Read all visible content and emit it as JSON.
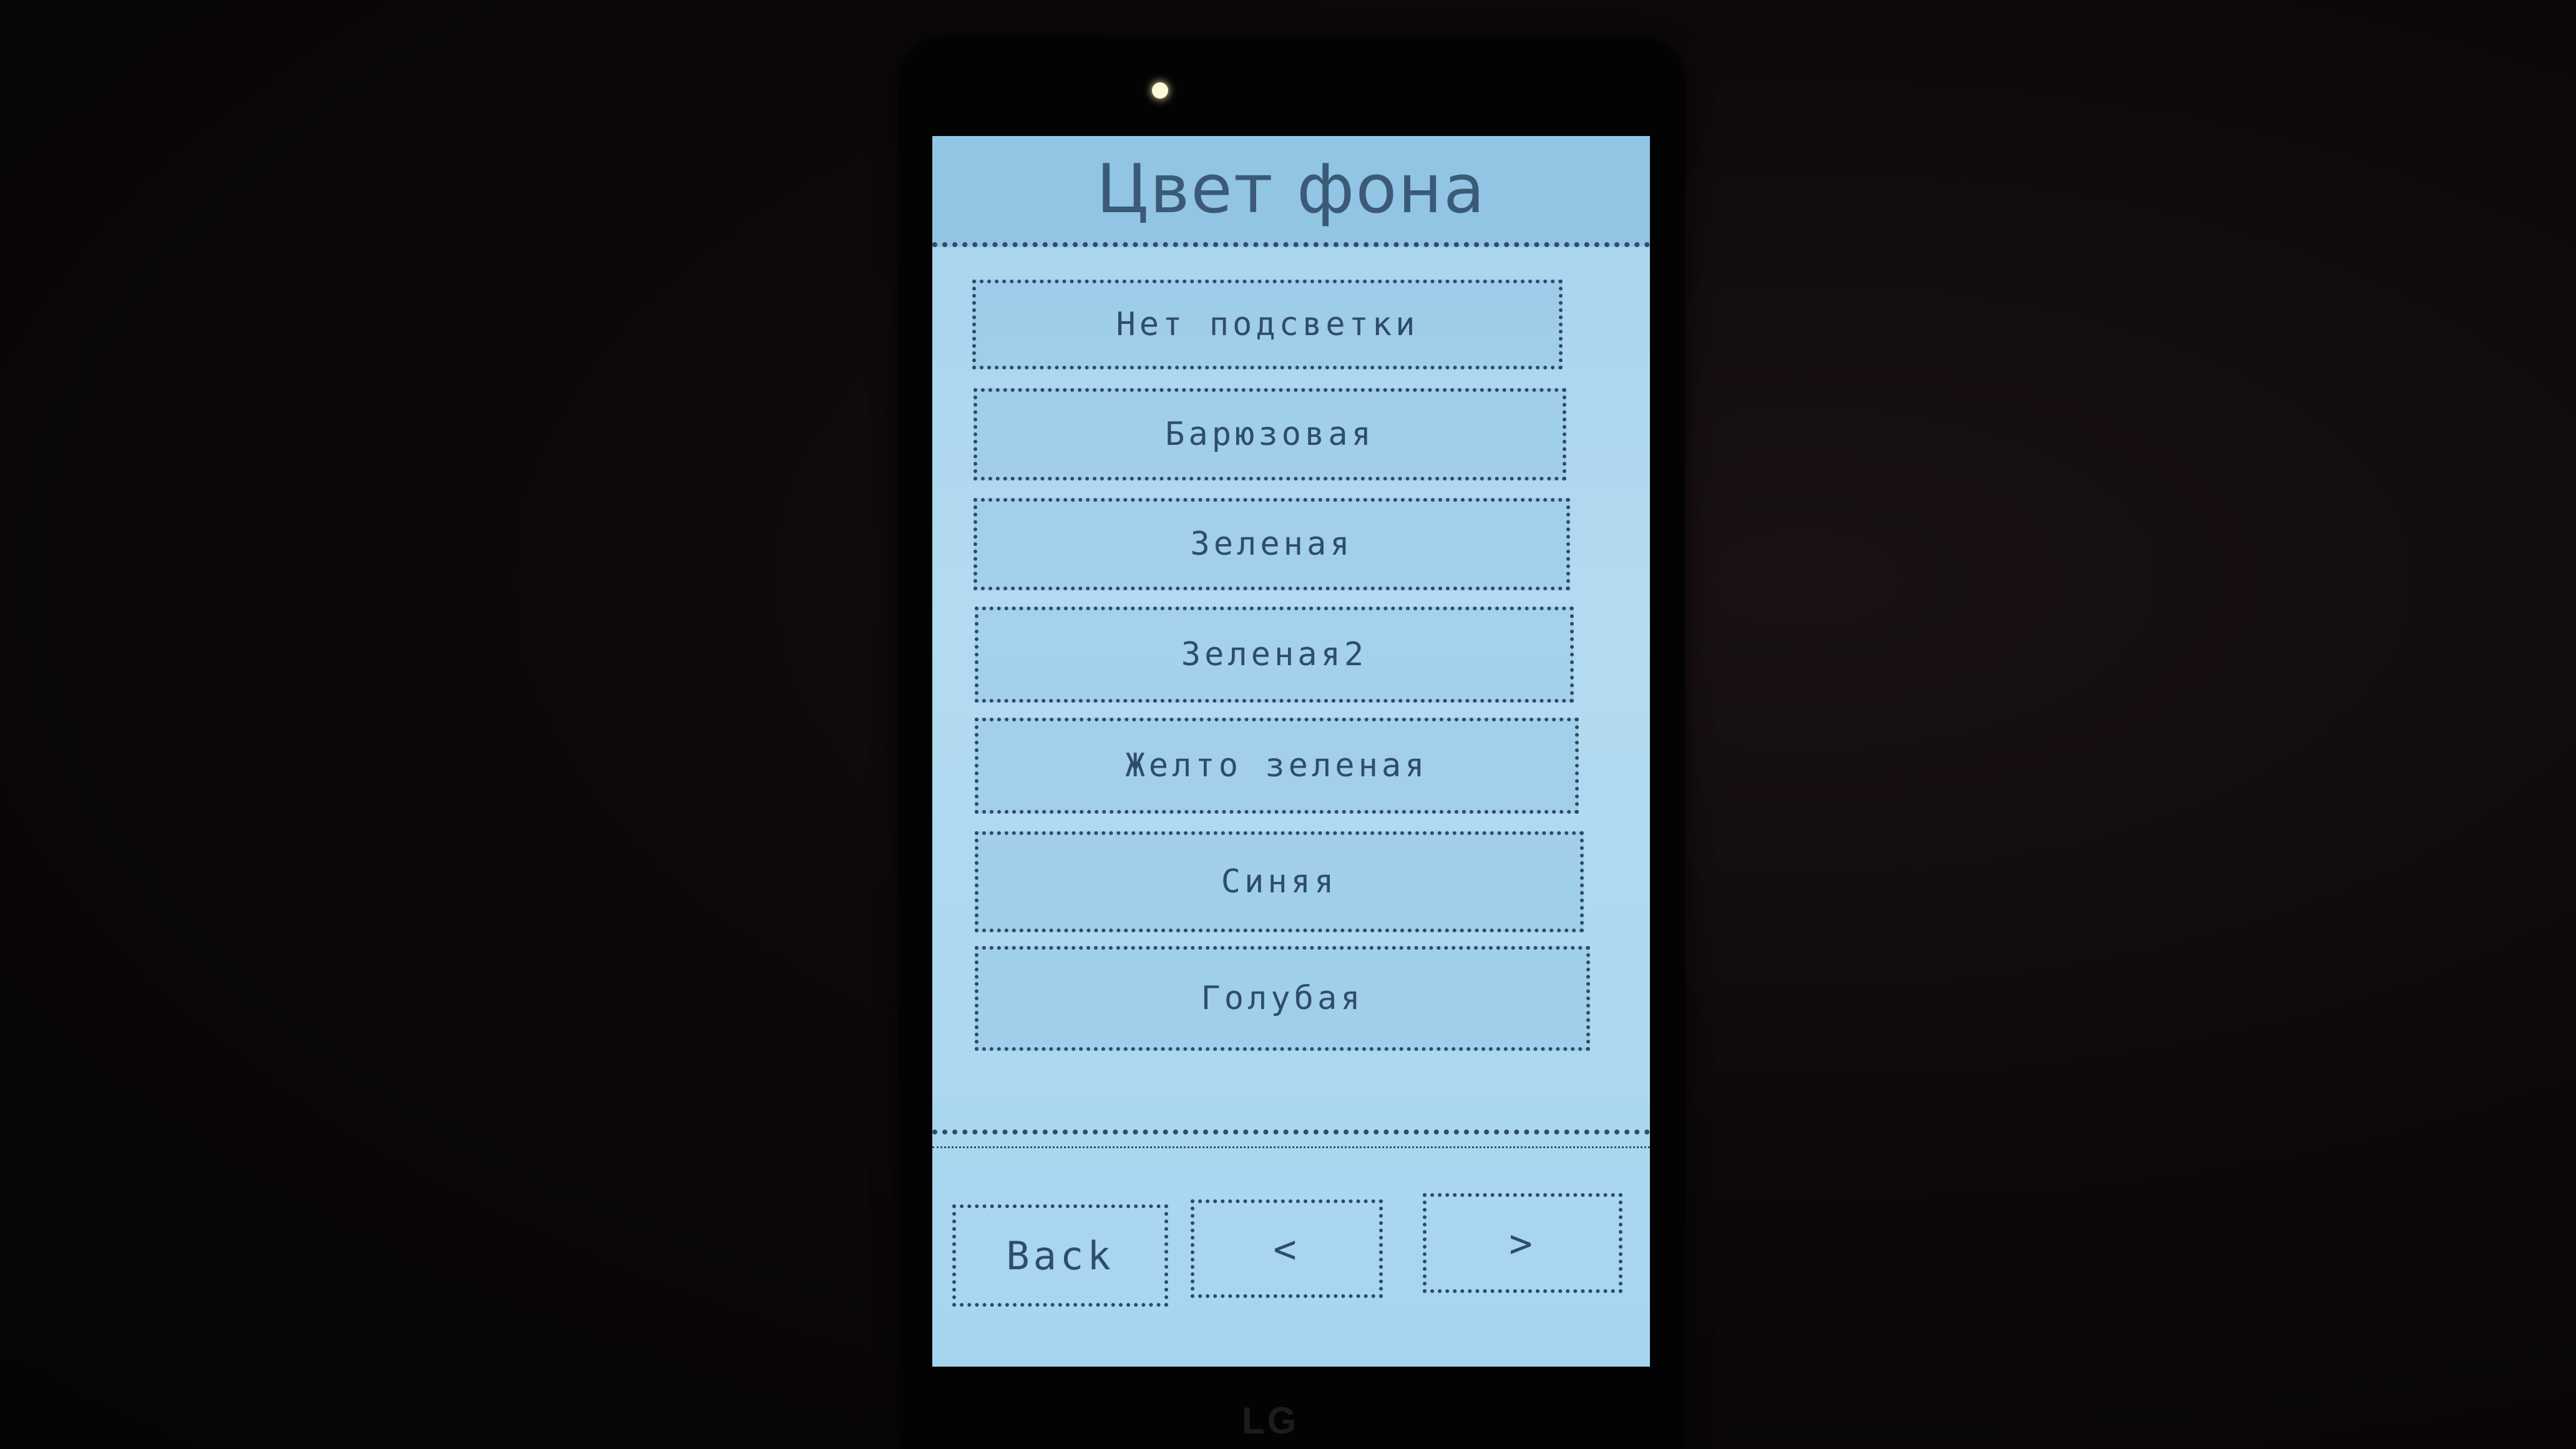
{
  "screen": {
    "title": "Цвет фона"
  },
  "menu": {
    "items": [
      {
        "label": "Нет подсветки"
      },
      {
        "label": "Барюзовая"
      },
      {
        "label": "Зеленая"
      },
      {
        "label": "Зеленая2"
      },
      {
        "label": "Желто зеленая"
      },
      {
        "label": "Синяя"
      },
      {
        "label": "Голубая"
      }
    ]
  },
  "footer": {
    "back_label": "Back",
    "prev_label": "<",
    "next_label": ">"
  },
  "device": {
    "brand": "LG"
  },
  "colors": {
    "screen_background": "#b3dbf1",
    "header_background": "#92c4e4",
    "text": "#2f4d6a",
    "border": "#2d4a66"
  }
}
